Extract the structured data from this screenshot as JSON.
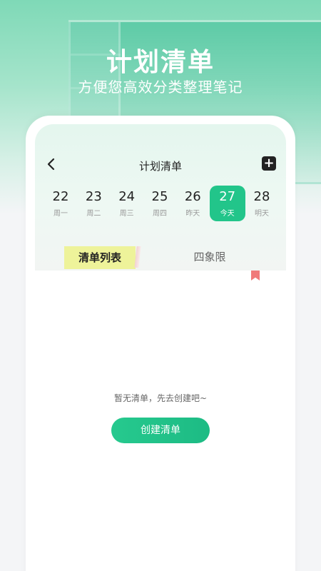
{
  "hero": {
    "title": "计划清单",
    "subtitle": "方便您高效分类整理笔记"
  },
  "nav": {
    "back_icon": "chevron-left-icon",
    "title": "计划清单",
    "add_icon": "plus-square-icon",
    "add_label": "+"
  },
  "week": {
    "days": [
      {
        "num": "22",
        "label": "周一"
      },
      {
        "num": "23",
        "label": "周二"
      },
      {
        "num": "24",
        "label": "周三"
      },
      {
        "num": "25",
        "label": "周四"
      },
      {
        "num": "26",
        "label": "昨天"
      },
      {
        "num": "27",
        "label": "今天",
        "active": true
      },
      {
        "num": "28",
        "label": "明天"
      }
    ]
  },
  "tabs": {
    "list": "清单列表",
    "quadrant": "四象限"
  },
  "content": {
    "bookmark_icon": "bookmark-icon",
    "empty_text": "暂无清单，先去创建吧~",
    "create_button": "创建清单"
  },
  "colors": {
    "accent": "#22c58a",
    "tab_highlight": "#eef39a",
    "bookmark": "#f07a7a"
  }
}
